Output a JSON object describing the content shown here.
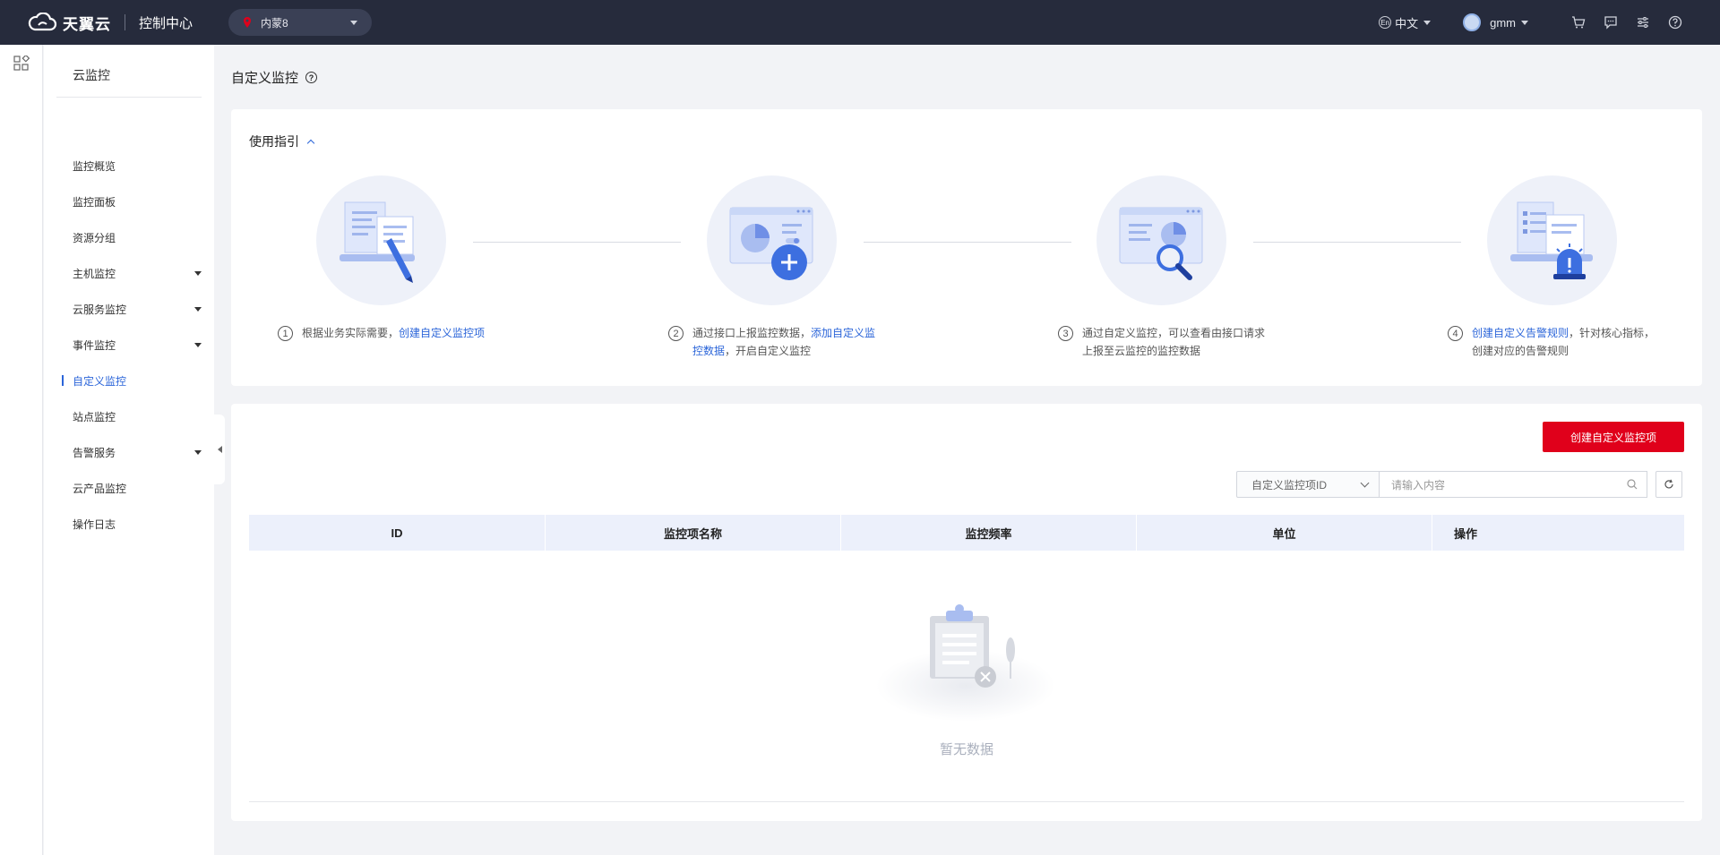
{
  "topbar": {
    "brand": "天翼云",
    "console": "控制中心",
    "region": "内蒙8",
    "language": "中文",
    "language_badge": "En",
    "username": "gmm"
  },
  "sidebar": {
    "title": "云监控",
    "items": [
      {
        "label": "监控概览",
        "expandable": false
      },
      {
        "label": "监控面板",
        "expandable": false
      },
      {
        "label": "资源分组",
        "expandable": false
      },
      {
        "label": "主机监控",
        "expandable": true
      },
      {
        "label": "云服务监控",
        "expandable": true
      },
      {
        "label": "事件监控",
        "expandable": true
      },
      {
        "label": "自定义监控",
        "expandable": false,
        "active": true
      },
      {
        "label": "站点监控",
        "expandable": false
      },
      {
        "label": "告警服务",
        "expandable": true
      },
      {
        "label": "云产品监控",
        "expandable": false
      },
      {
        "label": "操作日志",
        "expandable": false
      }
    ]
  },
  "page": {
    "title": "自定义监控"
  },
  "guide": {
    "title": "使用指引",
    "steps": [
      {
        "num": "1",
        "pre": "根据业务实际需要，",
        "link": "创建自定义监控项",
        "post": ""
      },
      {
        "num": "2",
        "pre": "通过接口上报监控数据，",
        "link": "添加自定义监控数据",
        "post": "，开启自定义监控"
      },
      {
        "num": "3",
        "pre": "通过自定义监控，可以查看由接口请求上报至云监控的监控数据",
        "link": "",
        "post": ""
      },
      {
        "num": "4",
        "pre": "",
        "link": "创建自定义告警规则",
        "post": "，针对核心指标，创建对应的告警规则"
      }
    ]
  },
  "toolbar": {
    "create_label": "创建自定义监控项",
    "filter_value": "自定义监控项ID",
    "search_placeholder": "请输入内容"
  },
  "table": {
    "columns": [
      "ID",
      "监控项名称",
      "监控频率",
      "单位",
      "操作"
    ],
    "empty_text": "暂无数据"
  },
  "colors": {
    "accent": "#2b65d9",
    "primary_button": "#e0001b",
    "topbar": "#262b3c"
  }
}
